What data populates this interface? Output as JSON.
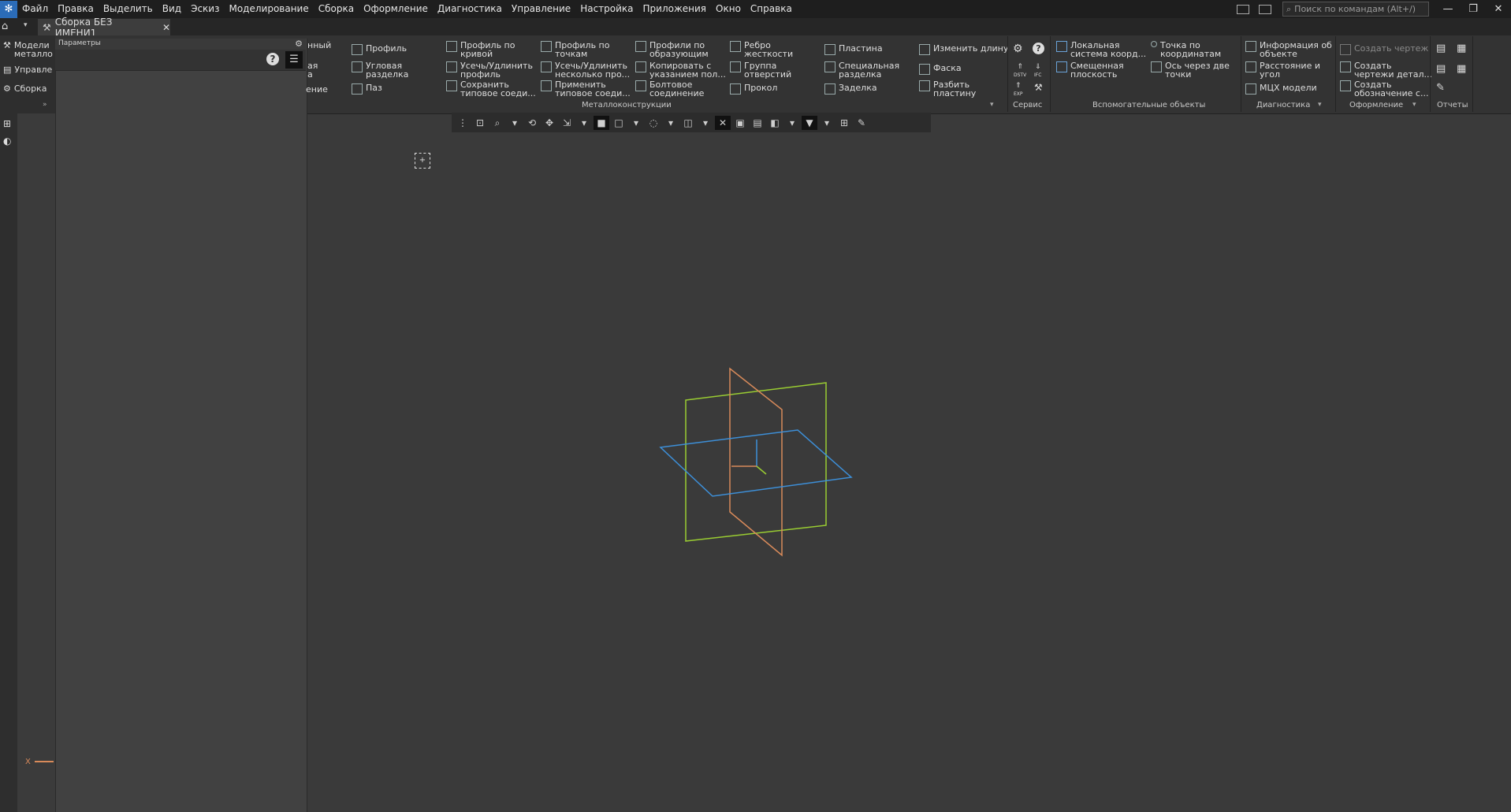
{
  "menubar": {
    "items": [
      "Файл",
      "Правка",
      "Выделить",
      "Вид",
      "Эскиз",
      "Моделирование",
      "Сборка",
      "Оформление",
      "Диагностика",
      "Управление",
      "Настройка",
      "Приложения",
      "Окно",
      "Справка"
    ],
    "search_placeholder": "Поиск по командам (Alt+/)"
  },
  "tab": {
    "title": "Сборка БЕЗ ИМЕНИ1",
    "close": "✕"
  },
  "left_panel": {
    "items": [
      "Модели металло",
      "Управле",
      "Сборка"
    ],
    "params_title": "Параметры"
  },
  "ribbon": {
    "partial_col": [
      "нный",
      "ая",
      "а",
      "ение"
    ],
    "buttons": {
      "profile": "Профиль",
      "corner_cut": "Угловая\nразделка",
      "groove": "Паз",
      "profile_curve": "Профиль по\nкривой",
      "trim_extend": "Усечь/Удлинить\nпрофиль",
      "save_joint": "Сохранить\nтиповое соеди...",
      "profile_points": "Профиль по\nточкам",
      "trim_several": "Усечь/Удлинить\nнесколько про...",
      "apply_joint": "Применить\nтиповое соеди...",
      "profiles_gen": "Профили по\nобразующим",
      "copy_with": "Копировать с\nуказанием пол...",
      "bolt": "Болтовое\nсоединение",
      "rib": "Ребро\nжесткости",
      "holes_group": "Группа\nотверстий",
      "pierce": "Прокол",
      "plate": "Пластина",
      "special_cut": "Специальная\nразделка",
      "embed": "Заделка",
      "change_length": "Изменить длину",
      "chamfer": "Фаска",
      "split_plate": "Разбить\nпластину",
      "local_cs": "Локальная\nсистема коорд...",
      "offset_plane": "Смещенная\nплоскость",
      "point_coords": "Точка по\nкоординатам",
      "axis_two_points": "Ось через две\nточки",
      "info_object": "Информация об\nобъекте",
      "distance_angle": "Расстояние и\nугол",
      "mcx": "МЦХ модели",
      "create_drawing": "Создать чертеж",
      "create_part_drawings": "Создать\nчертежи детал...",
      "create_designation": "Создать\nобозначение с..."
    },
    "service_labels": {
      "dstv": "DSTV",
      "ifc": "IFC",
      "exp": "EXP"
    },
    "groups": {
      "metal": "Металлоконструкции",
      "service": "Сервис",
      "aux": "Вспомогательные объекты",
      "diag": "Диагностика",
      "design": "Оформление",
      "reports": "Отчеты"
    }
  },
  "viewport": {
    "axis_label": "X"
  },
  "colors": {
    "plane_green": "#9acd32",
    "plane_orange": "#d88a5a",
    "plane_blue": "#3d8fd8"
  }
}
